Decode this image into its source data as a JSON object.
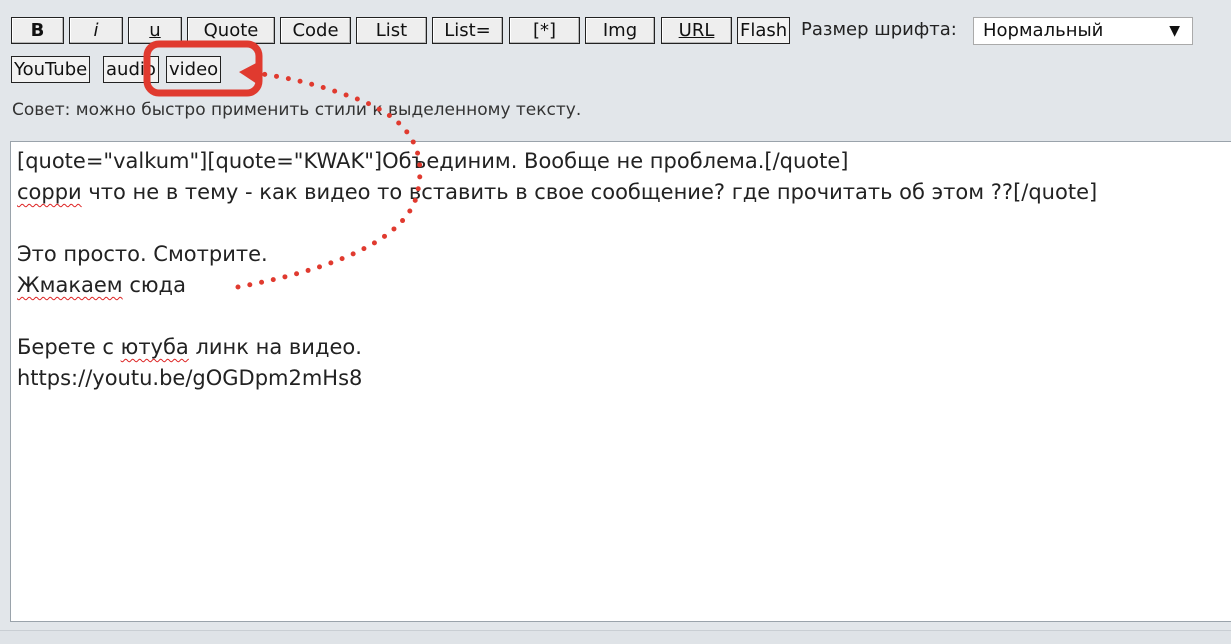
{
  "toolbar": {
    "bold": "B",
    "italic": "i",
    "underline": "u",
    "quote": "Quote",
    "code": "Code",
    "list": "List",
    "list_ordered": "List=",
    "list_item": "[*]",
    "img": "Img",
    "url": "URL",
    "flash": "Flash",
    "font_size_label": "Размер шрифта:",
    "font_size_value": "Нормальный",
    "youtube": "YouTube",
    "audio": "audio",
    "video": "video"
  },
  "tip": "Совет: можно быстро применить стили к выделенному тексту.",
  "editor": {
    "line1": "[quote=\"valkum\"][quote=\"KWAK\"]Объединим. Вообще не проблема.[/quote]",
    "line2_a": "сорри",
    "line2_b": " что не в тему - как видео то вставить в свое сообщение? где прочитать об этом ??[/quote]",
    "line4": "Это просто. Смотрите.",
    "line5_a": "Жмакаем",
    "line5_b": " сюда",
    "line7_a": "Берете с ",
    "line7_b": "ютуба",
    "line7_c": " линк на видео.",
    "line8": "https://youtu.be/gOGDpm2mHs8"
  },
  "annotation": {
    "color": "#e03a2f"
  }
}
